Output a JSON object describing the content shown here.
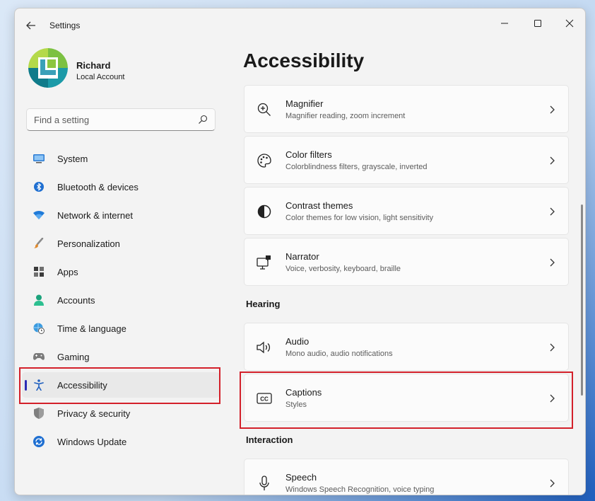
{
  "window": {
    "title": "Settings"
  },
  "profile": {
    "name": "Richard",
    "account_type": "Local Account"
  },
  "search": {
    "placeholder": "Find a setting"
  },
  "sidebar": {
    "items": [
      {
        "label": "System",
        "icon": "monitor-icon"
      },
      {
        "label": "Bluetooth & devices",
        "icon": "bluetooth-icon"
      },
      {
        "label": "Network & internet",
        "icon": "wifi-icon"
      },
      {
        "label": "Personalization",
        "icon": "brush-icon"
      },
      {
        "label": "Apps",
        "icon": "apps-icon"
      },
      {
        "label": "Accounts",
        "icon": "person-icon"
      },
      {
        "label": "Time & language",
        "icon": "globe-clock-icon"
      },
      {
        "label": "Gaming",
        "icon": "gamepad-icon"
      },
      {
        "label": "Accessibility",
        "icon": "accessibility-icon",
        "selected": true
      },
      {
        "label": "Privacy & security",
        "icon": "shield-icon"
      },
      {
        "label": "Windows Update",
        "icon": "update-icon"
      }
    ]
  },
  "main": {
    "title": "Accessibility",
    "vision_cards": [
      {
        "title": "Magnifier",
        "subtitle": "Magnifier reading, zoom increment",
        "icon": "magnifier-icon"
      },
      {
        "title": "Color filters",
        "subtitle": "Colorblindness filters, grayscale, inverted",
        "icon": "palette-icon"
      },
      {
        "title": "Contrast themes",
        "subtitle": "Color themes for low vision, light sensitivity",
        "icon": "contrast-icon"
      },
      {
        "title": "Narrator",
        "subtitle": "Voice, verbosity, keyboard, braille",
        "icon": "narrator-icon"
      }
    ],
    "hearing_label": "Hearing",
    "hearing_cards": [
      {
        "title": "Audio",
        "subtitle": "Mono audio, audio notifications",
        "icon": "speaker-icon"
      },
      {
        "title": "Captions",
        "subtitle": "Styles",
        "icon": "captions-icon"
      }
    ],
    "interaction_label": "Interaction",
    "interaction_cards": [
      {
        "title": "Speech",
        "subtitle": "Windows Speech Recognition, voice typing",
        "icon": "microphone-icon"
      }
    ]
  },
  "colors": {
    "accent": "#2b2bb5",
    "highlight": "#d3202a"
  }
}
